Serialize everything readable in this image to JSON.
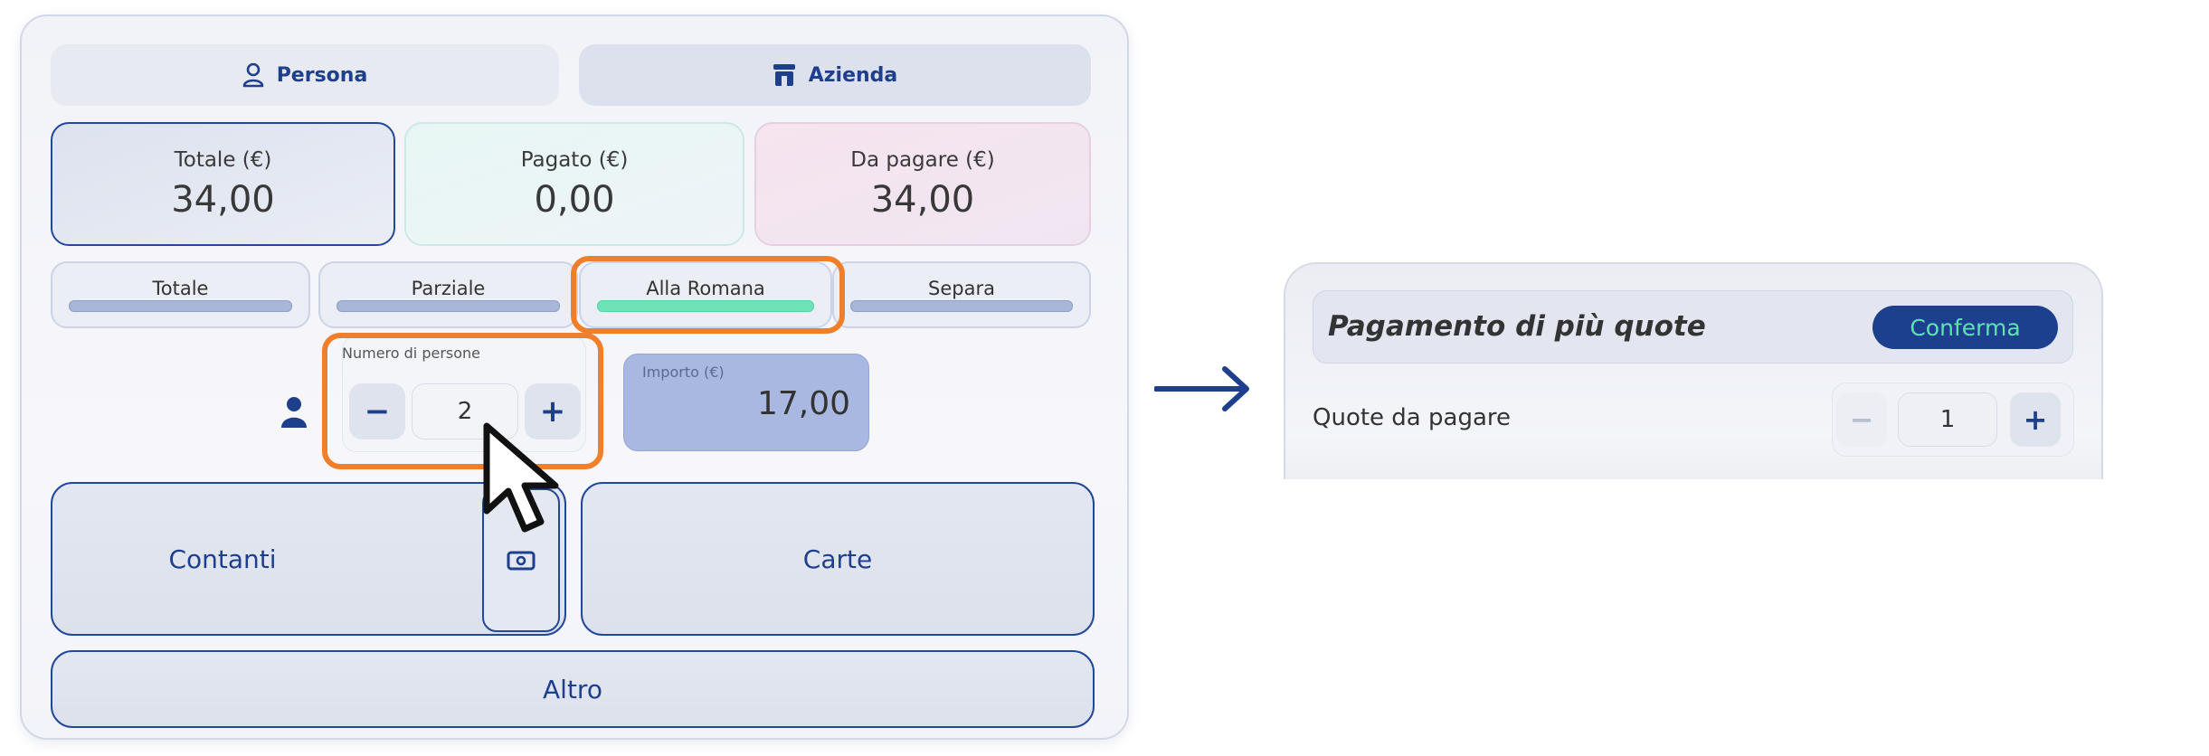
{
  "customer_type": {
    "options": [
      {
        "label": "Persona",
        "icon": "person-icon"
      },
      {
        "label": "Azienda",
        "icon": "store-icon"
      }
    ],
    "selected": "Azienda"
  },
  "summary": {
    "total": {
      "label": "Totale (€)",
      "value": "34,00"
    },
    "paid": {
      "label": "Pagato (€)",
      "value": "0,00"
    },
    "due": {
      "label": "Da pagare (€)",
      "value": "34,00"
    }
  },
  "split_modes": {
    "tabs": [
      "Totale",
      "Parziale",
      "Alla Romana",
      "Separa"
    ],
    "selected": "Alla Romana"
  },
  "people": {
    "label": "Numero di persone",
    "value": "2",
    "minus": "−",
    "plus": "+"
  },
  "amount": {
    "label": "Importo (€)",
    "value": "17,00"
  },
  "payment_buttons": {
    "cash": "Contanti",
    "cards": "Carte",
    "other": "Altro"
  },
  "shares_dialog": {
    "title": "Pagamento di più quote",
    "confirm": "Conferma",
    "quantity_label": "Quote da pagare",
    "value": "1",
    "minus": "−",
    "plus": "+",
    "minus_disabled": true
  },
  "colors": {
    "primary": "#1d3f8c",
    "accent_green": "#6fe2b7",
    "highlight_orange": "#ef7f2a"
  }
}
